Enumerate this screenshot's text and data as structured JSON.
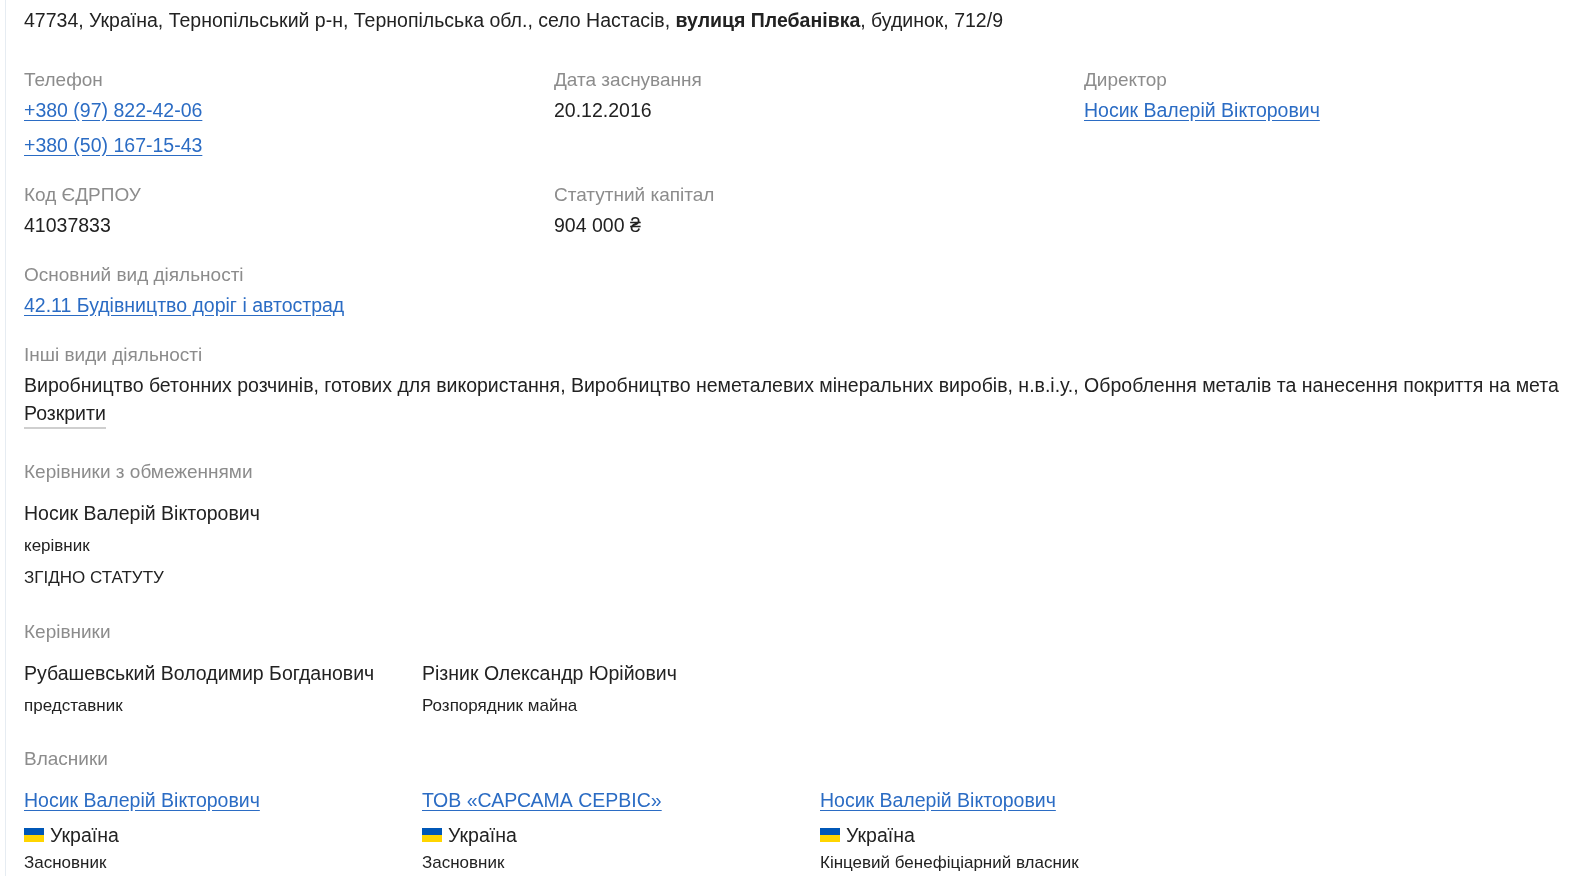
{
  "address": "47734, Україна, Тернопільський р-н, Тернопільська обл., село Настасів, **вулиця Плебанівка**, будинок, 712/9",
  "details": [
    {
      "label": "Телефон",
      "kind": "link",
      "values": [
        "+380 (97) 822-42-06",
        "+380 (50) 167-15-43"
      ]
    },
    {
      "label": "Дата заснування",
      "kind": "text",
      "values": [
        "20.12.2016"
      ]
    },
    {
      "label": "Директор",
      "kind": "link",
      "values": [
        "Носик Валерій Вікторович"
      ]
    },
    {
      "label": "Код ЄДРПОУ",
      "kind": "text",
      "values": [
        "41037833"
      ]
    },
    {
      "label": "Статутний капітал",
      "kind": "text",
      "values": [
        "904 000 ₴"
      ]
    }
  ],
  "main_activity": {
    "label": "Основний вид діяльності",
    "value": "42.11 Будівництво доріг і автострад"
  },
  "other_activities": {
    "label": "Інші види діяльності",
    "text": "Виробництво бетонних розчинів, готових для використання, Виробництво неметалевих мінеральних виробів, н.в.і.у., Оброблення металів та нанесення покриття на мета",
    "expand_button": "Розкрити"
  },
  "restricted_managers": {
    "title": "Керівники з обмеженнями",
    "people": [
      {
        "name": "Носик Валерій Вікторович",
        "role": "керівник",
        "basis": "ЗГІДНО СТАТУТУ"
      }
    ]
  },
  "managers": {
    "title": "Керівники",
    "people": [
      {
        "name": "Рубашевський Володимир Богданович",
        "role": "представник"
      },
      {
        "name": "Різник Олександр Юрійович",
        "role": "Розпорядник майна"
      }
    ]
  },
  "owners": {
    "title": "Власники",
    "people": [
      {
        "name": "Носик Валерій Вікторович",
        "country": "Україна",
        "role": "Засновник"
      },
      {
        "name": "ТОВ «САРСАМА СЕРВІС»",
        "country": "Україна",
        "role": "Засновник"
      },
      {
        "name": "Носик Валерій Вікторович",
        "country": "Україна",
        "role": "Кінцевий бенефіціарний власник"
      }
    ]
  }
}
